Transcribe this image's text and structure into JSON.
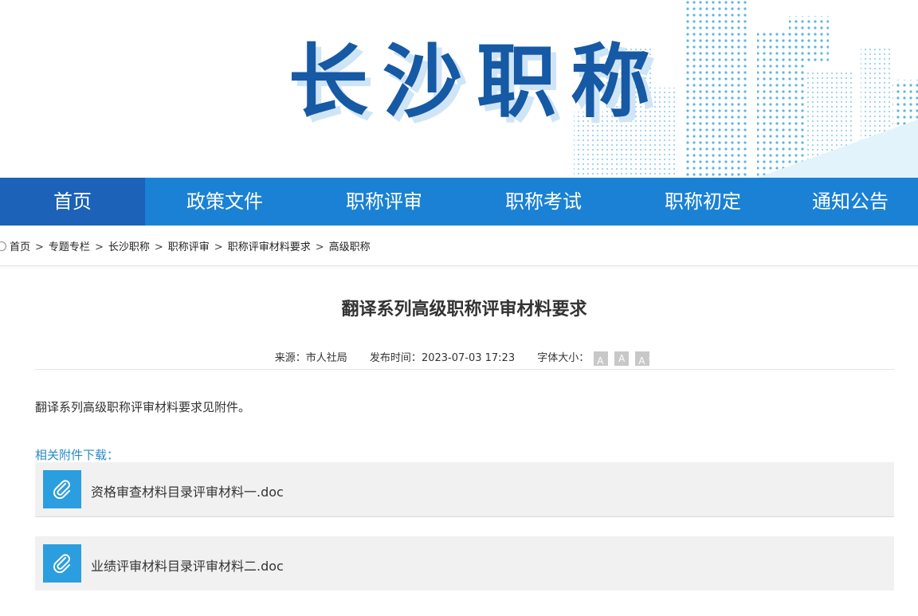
{
  "site": {
    "title": "长沙职称"
  },
  "nav": {
    "items": [
      {
        "label": "首页"
      },
      {
        "label": "政策文件"
      },
      {
        "label": "职称评审"
      },
      {
        "label": "职称考试"
      },
      {
        "label": "职称初定"
      },
      {
        "label": "通知公告"
      }
    ],
    "active_index": 0,
    "color": "#1a81d5",
    "active_color": "#1c62b8"
  },
  "breadcrumb": {
    "items": [
      {
        "label": "首页"
      },
      {
        "label": "专题专栏"
      },
      {
        "label": "长沙职称"
      },
      {
        "label": "职称评审"
      },
      {
        "label": "职称评审材料要求"
      },
      {
        "label": "高级职称"
      }
    ],
    "separator": ">"
  },
  "article": {
    "title": "翻译系列高级职称评审材料要求",
    "source_label": "来源：",
    "source": "市人社局",
    "date_label": "发布时间：",
    "date": "2023-07-03 17:23",
    "font_size_label": "字体大小：",
    "font_buttons": {
      "increase": "A",
      "normal": "A",
      "decrease": "A"
    },
    "body": "翻译系列高级职称评审材料要求见附件。"
  },
  "attachments": {
    "heading": "相关附件下载：",
    "items": [
      {
        "name": "资格审查材料目录评审材料一.doc",
        "icon": "paperclip-icon"
      },
      {
        "name": "业绩评审材料目录评审材料二.doc",
        "icon": "paperclip-icon"
      }
    ],
    "accent": "#2a8bc7"
  }
}
